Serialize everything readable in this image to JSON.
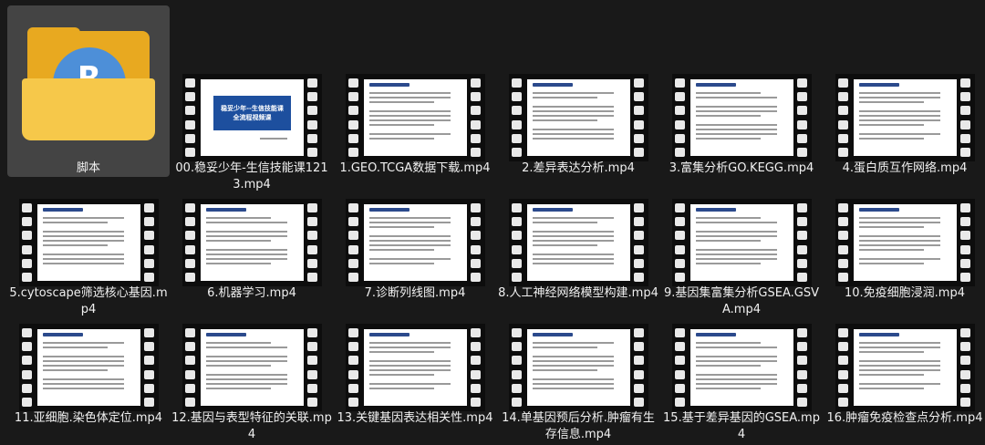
{
  "folder": {
    "label": "脚本",
    "logo_letter": "R"
  },
  "title_card": {
    "line1": "稳妥少年--生信技能课",
    "line2": "全流程视频课"
  },
  "items": [
    {
      "label": "00.稳妥少年-生信技能课1213.mp4"
    },
    {
      "label": "1.GEO.TCGA数据下载.mp4"
    },
    {
      "label": "2.差异表达分析.mp4"
    },
    {
      "label": "3.富集分析GO.KEGG.mp4"
    },
    {
      "label": "4.蛋白质互作网络.mp4"
    },
    {
      "label": "5.cytoscape筛选核心基因.mp4"
    },
    {
      "label": "6.机器学习.mp4"
    },
    {
      "label": "7.诊断列线图.mp4"
    },
    {
      "label": "8.人工神经网络模型构建.mp4"
    },
    {
      "label": "9.基因集富集分析GSEA.GSVA.mp4"
    },
    {
      "label": "10.免疫细胞浸润.mp4"
    },
    {
      "label": "11.亚细胞.染色体定位.mp4"
    },
    {
      "label": "12.基因与表型特征的关联.mp4"
    },
    {
      "label": "13.关键基因表达相关性.mp4"
    },
    {
      "label": "14.单基因预后分析.肿瘤有生存信息.mp4"
    },
    {
      "label": "15.基于差异基因的GSEA.mp4"
    },
    {
      "label": "16.肿瘤免疫检查点分析.mp4"
    }
  ]
}
